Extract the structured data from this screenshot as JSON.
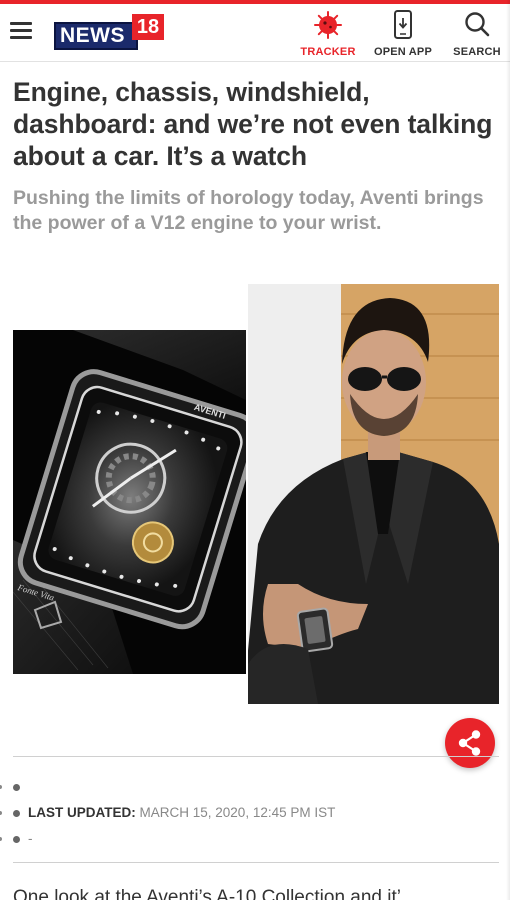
{
  "header": {
    "logo_text": "NEWS",
    "logo_number": "18",
    "nav": [
      {
        "label": "TRACKER",
        "icon": "virus-icon"
      },
      {
        "label": "OPEN APP",
        "icon": "phone-download-icon"
      },
      {
        "label": "SEARCH",
        "icon": "search-icon"
      }
    ]
  },
  "article": {
    "headline": "Engine, chassis, windshield, dashboard: and we’re not even talking about a car. It’s a watch",
    "subheadline": "Pushing the limits of horology today, Aventi brings the power of a V12 engine to your wrist.",
    "watch_brand": "AVENTI",
    "watch_engraving": "Fonte Vita"
  },
  "meta": {
    "first": "",
    "updated_label": "LAST UPDATED:",
    "updated_value": "MARCH 15, 2020, 12:45 PM IST",
    "third": "-"
  },
  "body_preview": "One look at the Aventi’s A-10 Collection and it’...",
  "colors": {
    "accent": "#e8242a",
    "logo_blue": "#1b2a6b",
    "headline": "#333333",
    "subhead": "#9a9a9a"
  }
}
